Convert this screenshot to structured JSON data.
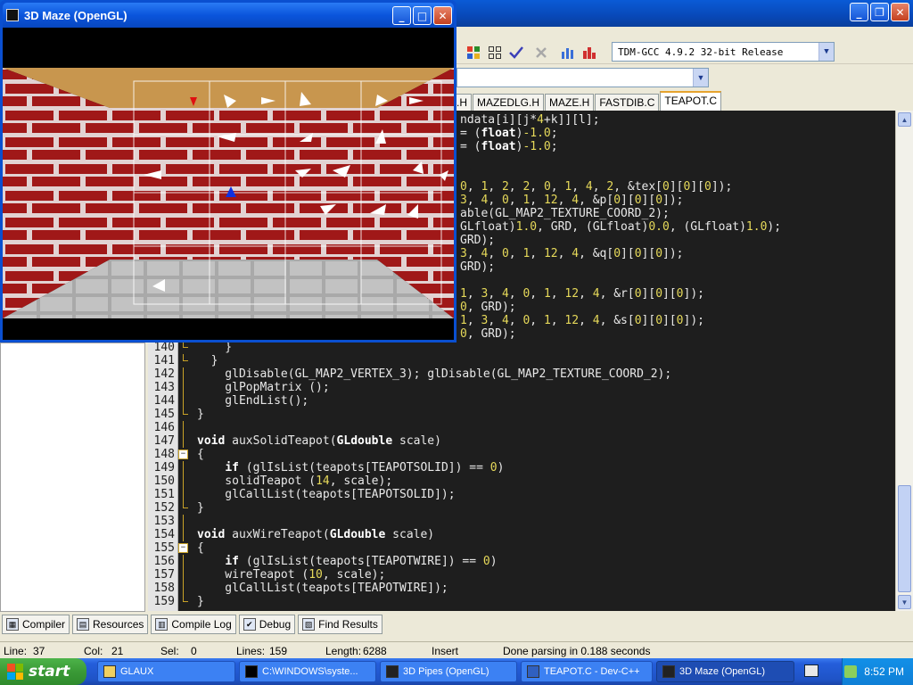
{
  "ide": {
    "minimize_glyph": "_",
    "restore_glyph": "❐",
    "close_glyph": "✕",
    "compiler": "TDM-GCC 4.9.2 32-bit Release",
    "tabs": [
      ".H",
      "MAZEDLG.H",
      "MAZE.H",
      "FASTDIB.C",
      "TEAPOT.C"
    ],
    "active_tab": "TEAPOT.C"
  },
  "maze_window": {
    "title": "3D Maze (OpenGL)",
    "colors": {
      "ceiling": "#c8964e",
      "brick": "#a01818",
      "mortar": "#e8d8d8",
      "floor": "#a8a8a8"
    }
  },
  "code_lines": [
    {
      "n": "",
      "fold": "",
      "t": "ndata[i][j*4+k]][l];"
    },
    {
      "n": "",
      "fold": "",
      "t": "= (float)-1.0;"
    },
    {
      "n": "",
      "fold": "",
      "t": "= (float)-1.0;"
    },
    {
      "n": "",
      "fold": "",
      "t": ""
    },
    {
      "n": "",
      "fold": "",
      "t": ""
    },
    {
      "n": "",
      "fold": "",
      "t": "0, 1, 2, 2, 0, 1, 4, 2, &tex[0][0][0]);"
    },
    {
      "n": "",
      "fold": "",
      "t": "3, 4, 0, 1, 12, 4, &p[0][0][0]);"
    },
    {
      "n": "",
      "fold": "",
      "t": "able(GL_MAP2_TEXTURE_COORD_2);"
    },
    {
      "n": "",
      "fold": "",
      "t": "GLfloat)1.0, GRD, (GLfloat)0.0, (GLfloat)1.0);"
    },
    {
      "n": "",
      "fold": "",
      "t": "GRD);"
    },
    {
      "n": "",
      "fold": "",
      "t": "3, 4, 0, 1, 12, 4, &q[0][0][0]);"
    },
    {
      "n": "",
      "fold": "",
      "t": "GRD);"
    },
    {
      "n": "",
      "fold": "",
      "t": ""
    },
    {
      "n": "",
      "fold": "",
      "t": "1, 3, 4, 0, 1, 12, 4, &r[0][0][0]);"
    },
    {
      "n": "",
      "fold": "",
      "t": "0, GRD);"
    },
    {
      "n": "",
      "fold": "",
      "t": "1, 3, 4, 0, 1, 12, 4, &s[0][0][0]);"
    },
    {
      "n": "",
      "fold": "",
      "t": "0, GRD);"
    },
    {
      "n": "140",
      "fold": "end",
      "t": "    }"
    },
    {
      "n": "141",
      "fold": "end",
      "t": "  }"
    },
    {
      "n": "142",
      "fold": "",
      "t": "    glDisable(GL_MAP2_VERTEX_3); glDisable(GL_MAP2_TEXTURE_COORD_2);"
    },
    {
      "n": "143",
      "fold": "",
      "t": "    glPopMatrix ();"
    },
    {
      "n": "144",
      "fold": "",
      "t": "    glEndList();"
    },
    {
      "n": "145",
      "fold": "end",
      "t": "}"
    },
    {
      "n": "146",
      "fold": "",
      "t": ""
    },
    {
      "n": "147",
      "fold": "",
      "t": "void auxSolidTeapot(GLdouble scale)"
    },
    {
      "n": "148",
      "fold": "start",
      "t": "{"
    },
    {
      "n": "149",
      "fold": "",
      "t": "    if (glIsList(teapots[TEAPOTSOLID]) == 0)"
    },
    {
      "n": "150",
      "fold": "",
      "t": "    solidTeapot (14, scale);"
    },
    {
      "n": "151",
      "fold": "",
      "t": "    glCallList(teapots[TEAPOTSOLID]);"
    },
    {
      "n": "152",
      "fold": "end",
      "t": "}"
    },
    {
      "n": "153",
      "fold": "",
      "t": ""
    },
    {
      "n": "154",
      "fold": "",
      "t": "void auxWireTeapot(GLdouble scale)"
    },
    {
      "n": "155",
      "fold": "start",
      "t": "{"
    },
    {
      "n": "156",
      "fold": "",
      "t": "    if (glIsList(teapots[TEAPOTWIRE]) == 0)"
    },
    {
      "n": "157",
      "fold": "",
      "t": "    wireTeapot (10, scale);"
    },
    {
      "n": "158",
      "fold": "",
      "t": "    glCallList(teapots[TEAPOTWIRE]);"
    },
    {
      "n": "159",
      "fold": "end",
      "t": "}"
    }
  ],
  "bottom_tabs": [
    {
      "label": "Compiler",
      "icon": "compiler-icon",
      "glyph": "▦"
    },
    {
      "label": "Resources",
      "icon": "resources-icon",
      "glyph": "▤"
    },
    {
      "label": "Compile Log",
      "icon": "compile-log-icon",
      "glyph": "▥"
    },
    {
      "label": "Debug",
      "icon": "debug-icon",
      "glyph": "✔"
    },
    {
      "label": "Find Results",
      "icon": "find-results-icon",
      "glyph": "▧"
    }
  ],
  "status": {
    "line_label": "Line:",
    "line_value": "37",
    "col_label": "Col:",
    "col_value": "21",
    "sel_label": "Sel:",
    "sel_value": "0",
    "lines_label": "Lines:",
    "lines_value": "159",
    "length_label": "Length:",
    "length_value": "6288",
    "mode": "Insert",
    "message": "Done parsing in 0.188 seconds"
  },
  "taskbar": {
    "start_label": "start",
    "tasks": [
      {
        "label": "GLAUX",
        "active": false
      },
      {
        "label": "C:\\WINDOWS\\syste...",
        "active": false
      },
      {
        "label": "3D Pipes (OpenGL)",
        "active": false
      },
      {
        "label": "TEAPOT.C - Dev-C++",
        "active": false
      },
      {
        "label": "3D Maze (OpenGL)",
        "active": true
      }
    ],
    "clock": "8:52 PM"
  }
}
